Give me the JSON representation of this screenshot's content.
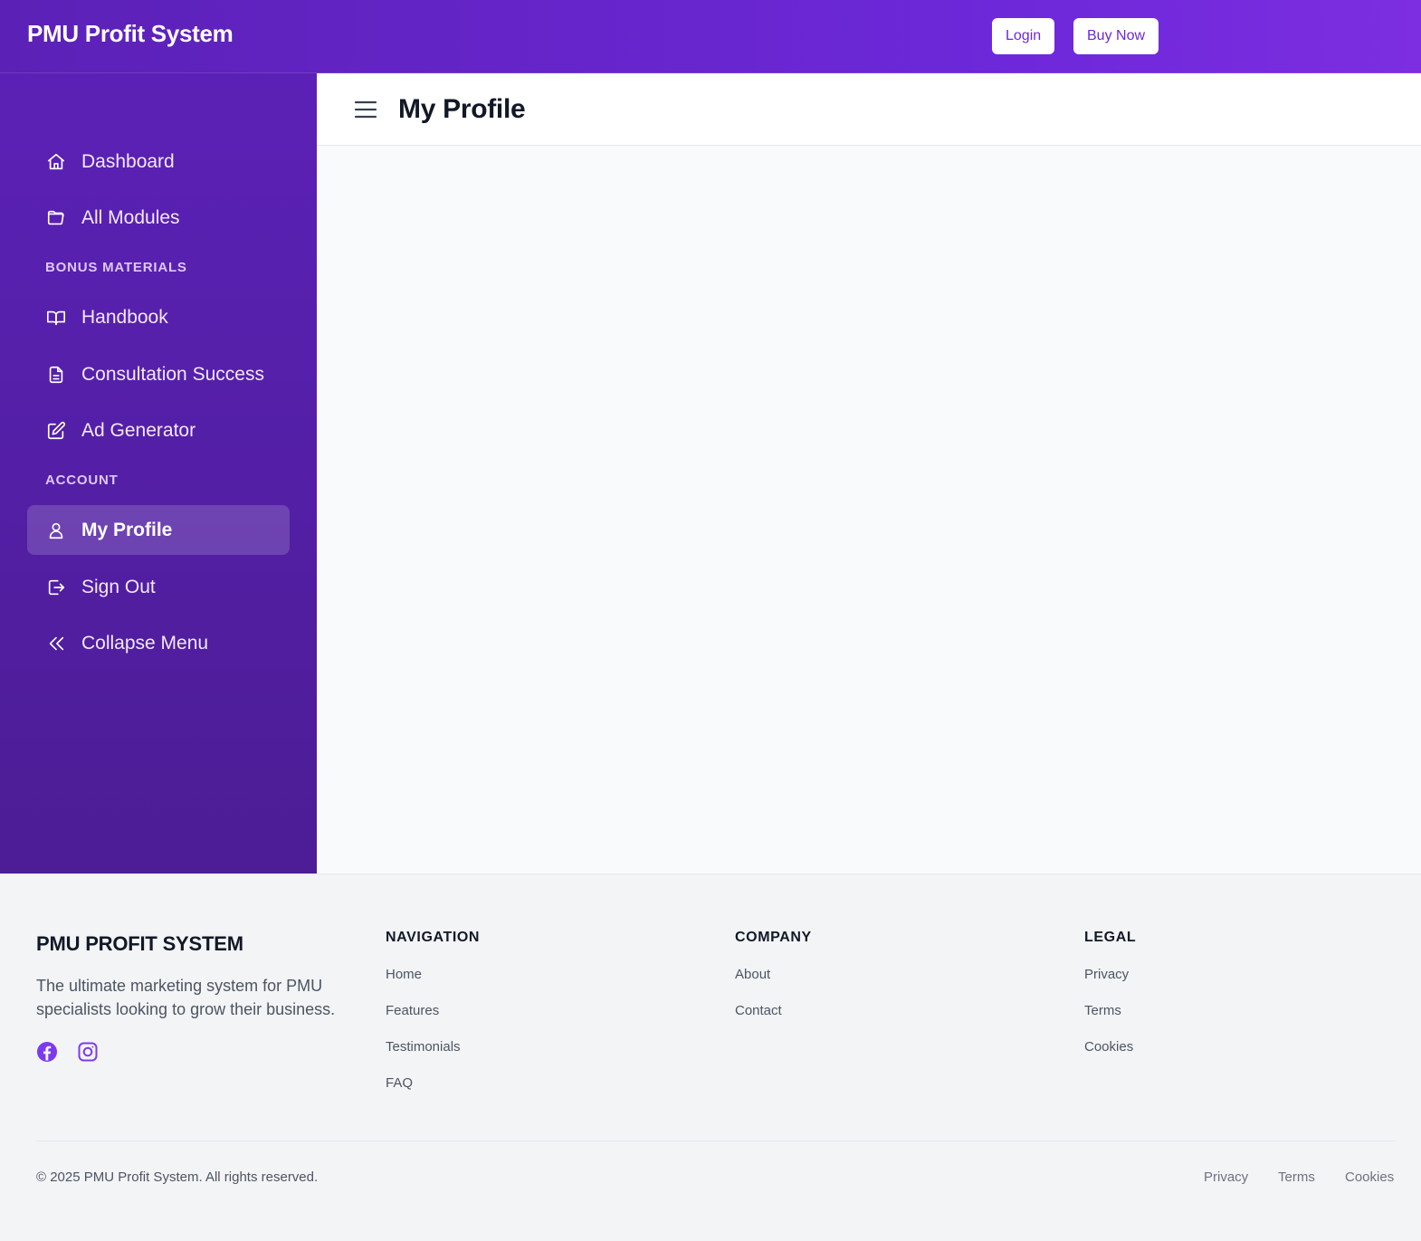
{
  "header": {
    "brand": "PMU Profit System",
    "login_label": "Login",
    "buy_label": "Buy Now"
  },
  "sidebar": {
    "items": [
      {
        "label": "Dashboard",
        "icon": "home-icon"
      },
      {
        "label": "All Modules",
        "icon": "folder-open-icon"
      },
      {
        "label": "Handbook",
        "icon": "book-open-icon"
      },
      {
        "label": "Consultation Success",
        "icon": "file-text-icon"
      },
      {
        "label": "Ad Generator",
        "icon": "edit-icon"
      },
      {
        "label": "My Profile",
        "icon": "user-icon",
        "active": true
      },
      {
        "label": "Sign Out",
        "icon": "sign-out-icon"
      },
      {
        "label": "Collapse Menu",
        "icon": "chevrons-left-icon"
      }
    ],
    "sections": {
      "bonus": "BONUS MATERIALS",
      "account": "ACCOUNT"
    }
  },
  "main": {
    "title": "My Profile"
  },
  "footer": {
    "brand": "PMU PROFIT SYSTEM",
    "description": "The ultimate marketing system for PMU specialists looking to grow their business.",
    "social": [
      "facebook-icon",
      "instagram-icon"
    ],
    "columns": [
      {
        "title": "NAVIGATION",
        "links": [
          "Home",
          "Features",
          "Testimonials",
          "FAQ"
        ]
      },
      {
        "title": "COMPANY",
        "links": [
          "About",
          "Contact"
        ]
      },
      {
        "title": "LEGAL",
        "links": [
          "Privacy",
          "Terms",
          "Cookies"
        ]
      }
    ],
    "copyright": "© 2025 PMU Profit System. All rights reserved.",
    "bottom_links": [
      "Privacy",
      "Terms",
      "Cookies"
    ]
  },
  "colors": {
    "brand_purple": "#6d28d9",
    "sidebar_top": "#5b21b6",
    "sidebar_bottom": "#4c1d95",
    "social_icon": "#7c3aed"
  }
}
